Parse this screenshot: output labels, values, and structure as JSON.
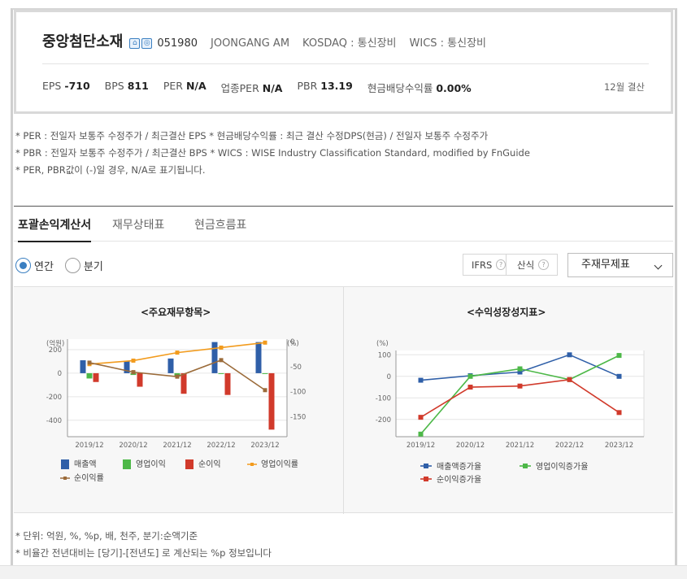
{
  "header": {
    "company": "중앙첨단소재",
    "code": "051980",
    "english_name": "JOONGANG AM",
    "market": "KOSDAQ : 통신장비",
    "wics": "WICS : 통신장비",
    "icon_names": [
      "home-icon",
      "camera-icon"
    ]
  },
  "ratios": [
    {
      "label": "EPS",
      "value": "-710"
    },
    {
      "label": "BPS",
      "value": "811"
    },
    {
      "label": "PER",
      "value": "N/A"
    },
    {
      "label": "업종PER",
      "value": "N/A"
    },
    {
      "label": "PBR",
      "value": "13.19"
    },
    {
      "label": "현금배당수익률",
      "value": "0.00%"
    }
  ],
  "settlement": "12월 결산",
  "notes": [
    "* PER : 전일자 보통주 수정주가 / 최근결산 EPS * 현금배당수익률 : 최근 결산 수정DPS(현금) / 전일자 보통주 수정주가",
    "* PBR : 전일자 보통주 수정주가 / 최근결산 BPS * WICS : WISE Industry Classification Standard, modified by FnGuide",
    "* PER, PBR값이 (-)일 경우, N/A로 표기됩니다."
  ],
  "tabs": [
    "포괄손익계산서",
    "재무상태표",
    "현금흐름표"
  ],
  "period": {
    "options": [
      "연간",
      "분기"
    ],
    "selected": "연간"
  },
  "options": {
    "ifrs": "IFRS",
    "calc": "산식",
    "qmark": "?",
    "dropdown": "주재무제표"
  },
  "colors": {
    "sales": "#2f5fa8",
    "op_profit": "#4db848",
    "net_profit": "#d13a2b",
    "op_margin": "#f29b1d",
    "net_margin": "#9b6b3a",
    "accent": "#3a7fc1"
  },
  "chart_data": [
    {
      "type": "bar",
      "title": "<주요재무항목>",
      "categories": [
        "2019/12",
        "2020/12",
        "2021/12",
        "2022/12",
        "2023/12"
      ],
      "left_axis_label": "(억원)",
      "right_axis_label": "(%)",
      "ylim": [
        -540,
        290
      ],
      "y_ticks": [
        200,
        0,
        -200,
        -400
      ],
      "y2lim": [
        -190,
        5
      ],
      "y2_ticks": [
        0,
        -50,
        -100,
        -150
      ],
      "series": [
        {
          "name": "매출액",
          "kind": "bar",
          "axis": "left",
          "values": [
            110,
            105,
            125,
            265,
            265
          ]
        },
        {
          "name": "영업이익",
          "kind": "bar",
          "axis": "left",
          "values": [
            -45,
            -15,
            -30,
            0,
            0
          ]
        },
        {
          "name": "순이익",
          "kind": "bar",
          "axis": "left",
          "values": [
            -75,
            -115,
            -175,
            -185,
            -480
          ]
        },
        {
          "name": "영업이익률",
          "kind": "line",
          "axis": "right",
          "values": [
            -45,
            -38,
            -22,
            -12,
            -2
          ]
        },
        {
          "name": "순이익률",
          "kind": "line",
          "axis": "right",
          "values": [
            -42,
            -61,
            -70,
            -37,
            -97
          ]
        }
      ],
      "grid": true,
      "legend": "bottom"
    },
    {
      "type": "line",
      "title": "<수익성장성지표>",
      "categories": [
        "2019/12",
        "2020/12",
        "2021/12",
        "2022/12",
        "2023/12"
      ],
      "left_axis_label": "(%)",
      "ylim": [
        -280,
        120
      ],
      "y_ticks": [
        100,
        0,
        -100,
        -200
      ],
      "series": [
        {
          "name": "매출액증가율",
          "values": [
            -18,
            3,
            20,
            100,
            0
          ]
        },
        {
          "name": "영업이익증가율",
          "values": [
            -268,
            0,
            35,
            -15,
            97
          ]
        },
        {
          "name": "순이익증가율",
          "values": [
            -190,
            -50,
            -45,
            -15,
            -168
          ]
        }
      ],
      "grid": true,
      "legend": "bottom"
    }
  ],
  "unit_notes": [
    "* 단위: 억원, %, %p, 배, 천주, 분기:순액기준",
    "* 비율간 전년대비는 [당기]-[전년도] 로 계산되는 %p 정보입니다"
  ]
}
